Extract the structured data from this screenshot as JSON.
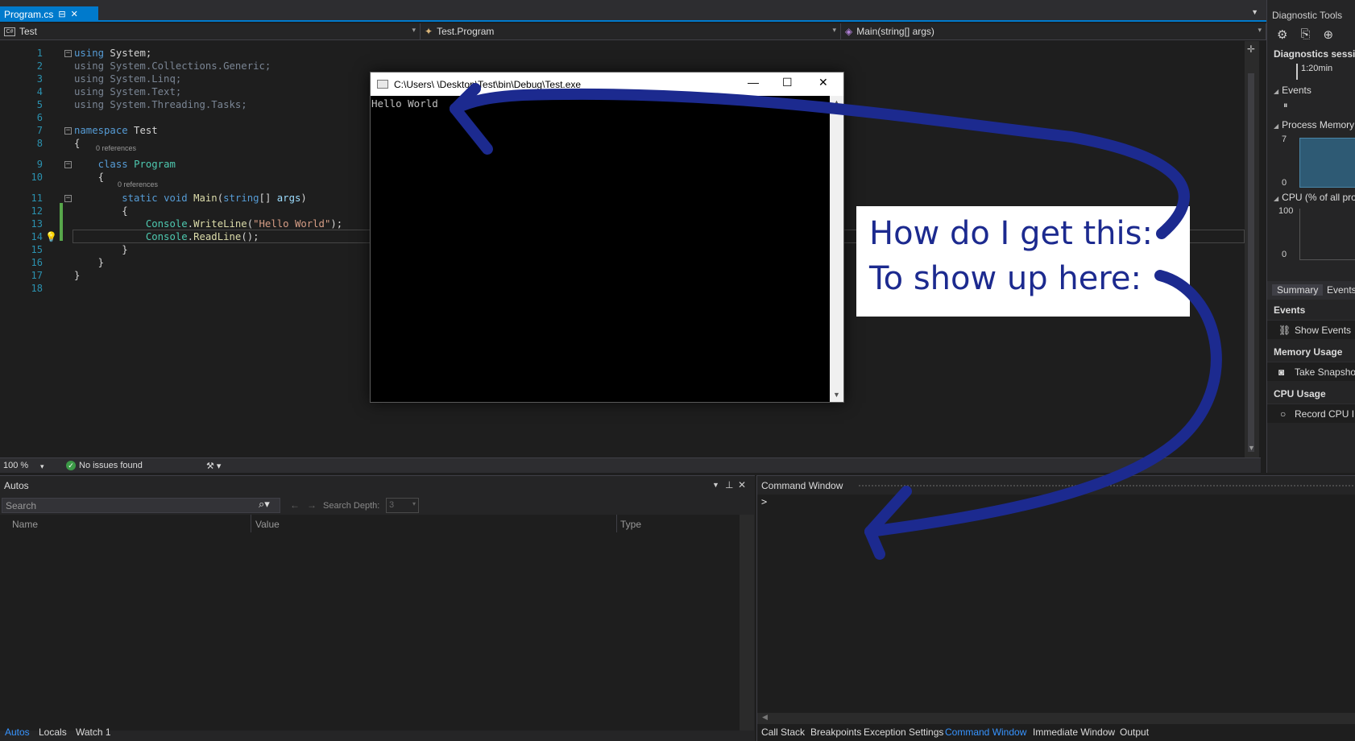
{
  "editor_tab": {
    "label": "Program.cs",
    "pin": "⊟",
    "close": "✕"
  },
  "navbar": {
    "project": "Test",
    "class": "Test.Program",
    "member": "Main(string[] args)"
  },
  "code_lines": [
    {
      "n": "1",
      "html": "<span class=\"k\">using</span> System;"
    },
    {
      "n": "2",
      "html": "<span class=\"dim\">using System.Collections.Generic;</span>"
    },
    {
      "n": "3",
      "html": "<span class=\"dim\">using System.Linq;</span>"
    },
    {
      "n": "4",
      "html": "<span class=\"dim\">using System.Text;</span>"
    },
    {
      "n": "5",
      "html": "<span class=\"dim\">using System.Threading.Tasks;</span>"
    },
    {
      "n": "6",
      "html": ""
    },
    {
      "n": "7",
      "html": "<span class=\"k\">namespace</span> Test"
    },
    {
      "n": "8",
      "html": "{"
    },
    {
      "n": "9",
      "html": "    <span class=\"k\">class</span> <span class=\"t\">Program</span>"
    },
    {
      "n": "10",
      "html": "    {"
    },
    {
      "n": "11",
      "html": "        <span class=\"k\">static</span> <span class=\"k\">void</span> <span class=\"m\">Main</span>(<span class=\"k\">string</span>[] <span class=\"p\">args</span>)"
    },
    {
      "n": "12",
      "html": "        {"
    },
    {
      "n": "13",
      "html": "            <span class=\"t\">Console</span>.<span class=\"m\">WriteLine</span>(<span class=\"s\">\"Hello World\"</span>);"
    },
    {
      "n": "14",
      "html": "            <span class=\"t\">Console</span>.<span class=\"m\">ReadLine</span>();"
    },
    {
      "n": "15",
      "html": "        }"
    },
    {
      "n": "16",
      "html": "    }"
    },
    {
      "n": "17",
      "html": "}"
    },
    {
      "n": "18",
      "html": ""
    }
  ],
  "code_refs": [
    "0 references",
    "0 references"
  ],
  "editor_status": {
    "zoom": "100 %",
    "issues": "No issues found"
  },
  "console_window": {
    "title": "C:\\Users\\      \\Desktop\\Test\\bin\\Debug\\Test.exe",
    "output": "Hello World"
  },
  "annotation": {
    "line1": "How do I get this:",
    "line2": "To show up here:"
  },
  "diagnostics": {
    "title": "Diagnostic Tools",
    "session": "Diagnostics sessio",
    "time": "1:20min",
    "events": "Events",
    "process_memory": "Process Memory",
    "mem_max": "7",
    "mem_min": "0",
    "cpu": "CPU (% of all pro",
    "cpu_max": "100",
    "cpu_min": "0",
    "tab_summary": "Summary",
    "tab_events": "Events",
    "events_section": "Events",
    "show_events": "Show Events",
    "memory_usage": "Memory Usage",
    "take_snapshot": "Take Snapsho",
    "cpu_usage": "CPU Usage",
    "record_cpu": "Record CPU I"
  },
  "autos": {
    "title": "Autos",
    "search_placeholder": "Search",
    "search_depth_label": "Search Depth:",
    "search_depth_value": "3",
    "columns": [
      "Name",
      "Value",
      "Type"
    ]
  },
  "left_tabs": [
    "Autos",
    "Locals",
    "Watch 1"
  ],
  "command_window": {
    "title": "Command Window",
    "prompt": ">"
  },
  "right_tabs": [
    "Call Stack",
    "Breakpoints",
    "Exception Settings",
    "Command Window",
    "Immediate Window",
    "Output"
  ],
  "colors": {
    "accent": "#007acc",
    "arrow": "#1c2a8f",
    "active_tab_text": "#3794ff"
  }
}
